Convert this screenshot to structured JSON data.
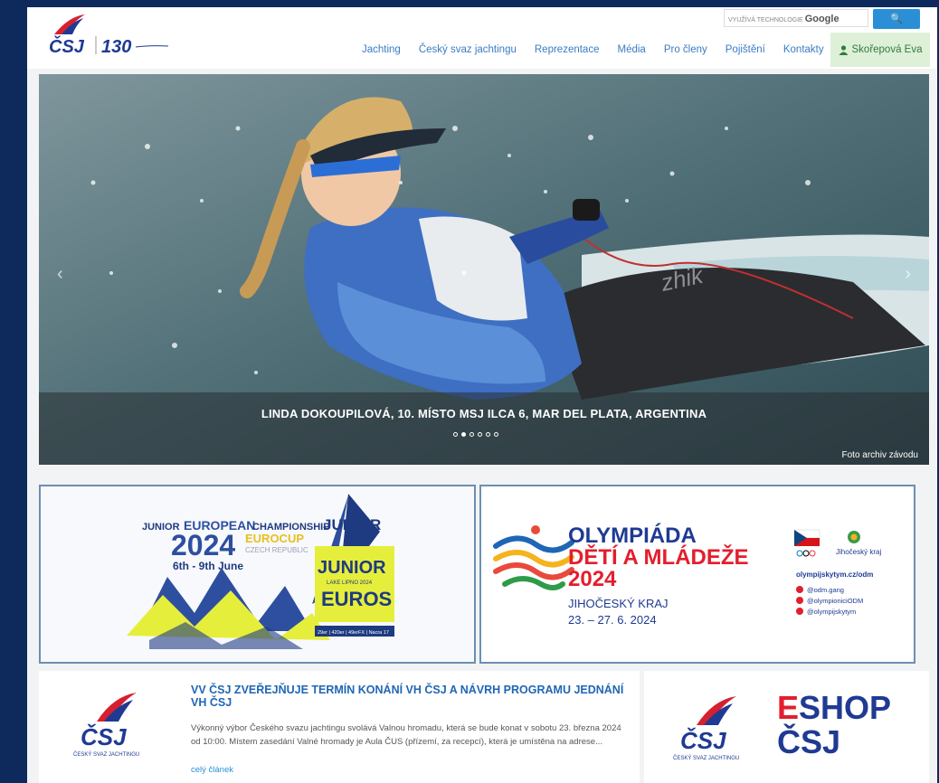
{
  "header": {
    "search_label": "VYUŽÍVÁ TECHNOLOGIE",
    "search_brand": "Google",
    "search_button": "🔍",
    "nav": [
      "Jachting",
      "Český svaz jachtingu",
      "Reprezentace",
      "Média",
      "Pro členy",
      "Pojištění",
      "Kontakty"
    ],
    "user": "Skořepová Eva",
    "logo_text": "ČSJ",
    "anniversary_text": "130"
  },
  "hero": {
    "caption": "LINDA DOKOUPILOVÁ, 10. MÍSTO MSJ ILCA 6, MAR DEL PLATA, ARGENTINA",
    "credit": "Foto archiv závodu",
    "slides": 6,
    "active_slide": 2,
    "sail_text": "zhik"
  },
  "banner_euros": {
    "line1_a": "JUNIOR",
    "line1_b": "EUROPEAN",
    "line1_c": "CHAMPIONSHIP",
    "year": "2024",
    "eurocup": "EUROCUP",
    "country": "CZECH REPUBLIC",
    "dates": "6th - 9th June",
    "badge1": "JUNIOR",
    "badge_sub": "LAKE LIPNO 2024",
    "badge2": "EUROS",
    "classes": "29er | 420er | 49erFX | Nacra 17"
  },
  "banner_olympiada": {
    "title1": "OLYMPIÁDA",
    "title2": "DĚTÍ A MLÁDEŽE",
    "year": "2024",
    "region": "JIHOČESKÝ KRAJ",
    "dates": "23. – 27. 6. 2024",
    "region_small": "Jihočeský kraj",
    "url": "olympijskytym.cz/odm",
    "social1": "@odm.gang",
    "social2": "@olympioniciODM",
    "social3": "@olympijskytym"
  },
  "news": {
    "title": "VV ČSJ ZVEŘEJŇUJE TERMÍN KONÁNÍ VH ČSJ A NÁVRH PROGRAMU JEDNÁNÍ VH ČSJ",
    "body": "Výkonný výbor Českého svazu jachtingu svolává  Valnou hromadu, která se bude konat v sobotu 23. března 2024 od 10:00. Místem zasedání Valné hromady je Aula ČUS (přízemí, za recepcí), která je umístěna na adrese...",
    "more": "celý článek",
    "logo_caption": "ČESKÝ SVAZ JACHTINGU"
  },
  "eshop": {
    "e": "E",
    "shop": "SHOP",
    "csj": "ČSJ",
    "logo_caption": "ČESKÝ SVAZ JACHTINGU"
  },
  "colors": {
    "nav_link": "#3a7cc4",
    "brand_blue": "#1f3a93",
    "brand_red": "#e31e2d",
    "background": "#0e2a5c"
  }
}
